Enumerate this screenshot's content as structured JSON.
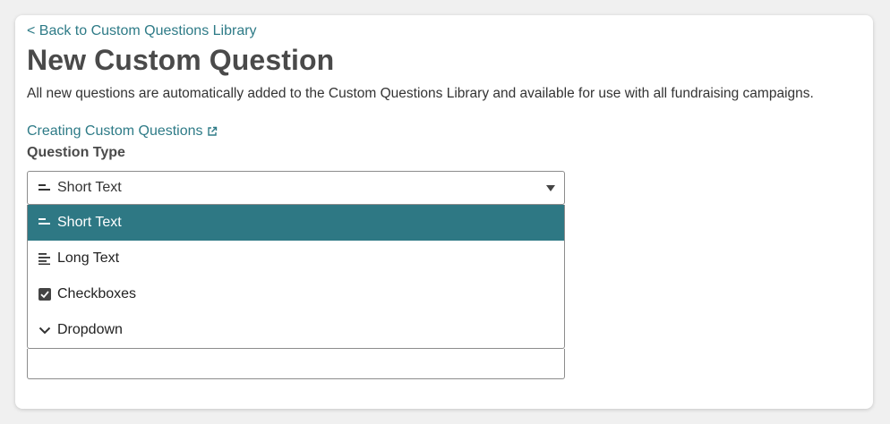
{
  "header": {
    "back_link": "< Back to Custom Questions Library",
    "title": "New Custom Question",
    "description": "All new questions are automatically added to the Custom Questions Library and available for use with all fundraising campaigns."
  },
  "help_link": {
    "label": "Creating Custom Questions",
    "icon": "external-link-icon"
  },
  "question_type": {
    "label": "Question Type",
    "selected": "Short Text",
    "selected_icon": "short-text-icon",
    "options": [
      {
        "label": "Short Text",
        "icon": "short-text-icon",
        "selected": true
      },
      {
        "label": "Long Text",
        "icon": "long-text-icon",
        "selected": false
      },
      {
        "label": "Checkboxes",
        "icon": "checkbox-icon",
        "selected": false
      },
      {
        "label": "Dropdown",
        "icon": "chevron-down-icon",
        "selected": false
      }
    ]
  },
  "colors": {
    "accent": "#2e7b87",
    "selected_option_bg": "#2e7884",
    "title": "#4a4a4a"
  }
}
